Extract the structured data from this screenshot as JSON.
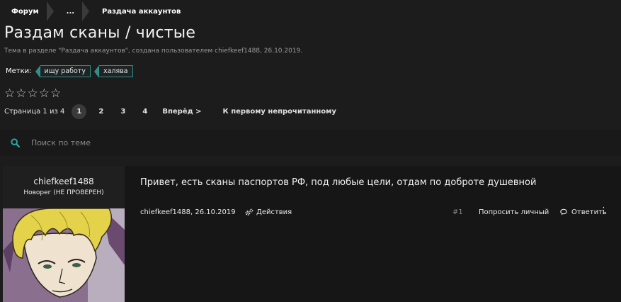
{
  "breadcrumb": {
    "items": [
      "Форум",
      "...",
      "Раздача аккаунтов"
    ]
  },
  "thread": {
    "title": "Раздам сканы / чистые",
    "subtitle": "Тема в разделе \"Раздача аккаунтов\", создана пользователем chiefkeef1488, 26.10.2019."
  },
  "tags": {
    "label": "Метки:",
    "items": [
      "ищу работу",
      "халява"
    ]
  },
  "rating": {
    "stars_filled": 0,
    "stars_total": 5,
    "glyph": "☆"
  },
  "pagination": {
    "label": "Страница 1 из 4",
    "pages": [
      "1",
      "2",
      "3",
      "4"
    ],
    "current": "1",
    "next": "Вперёд >",
    "first_unread": "К первому непрочитанному"
  },
  "search": {
    "placeholder": "Поиск по теме",
    "icon": "search-icon"
  },
  "post": {
    "author": "chiefkeef1488",
    "user_title": "Новорег (НЕ ПРОВЕРЕН)",
    "message": "Привет, есть сканы паспортов РФ, под любые цели, отдам по доброте душевной",
    "author_date": "chiefkeef1488, 26.10.2019",
    "actions": "Действия",
    "number": "#1",
    "private": "Попросить личный",
    "reply": "Ответить"
  },
  "colors": {
    "accent": "#2f8f8a",
    "background": "#1c1c1c"
  }
}
